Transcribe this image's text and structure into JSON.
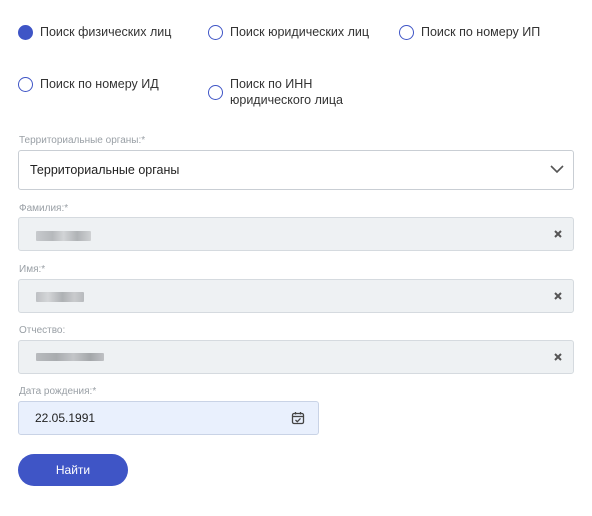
{
  "search_types": [
    {
      "label": "Поиск физических лиц",
      "checked": true
    },
    {
      "label": "Поиск юридических лиц",
      "checked": false
    },
    {
      "label": "Поиск по номеру ИП",
      "checked": false
    },
    {
      "label": "Поиск по номеру ИД",
      "checked": false
    },
    {
      "label": "Поиск по ИНН юридического лица",
      "checked": false
    }
  ],
  "form": {
    "territorial": {
      "label": "Территориальные органы:*",
      "value": "Территориальные органы"
    },
    "lastname": {
      "label": "Фамилия:*"
    },
    "firstname": {
      "label": "Имя:*"
    },
    "patronymic": {
      "label": "Отчество:"
    },
    "birthdate": {
      "label": "Дата рождения:*",
      "value": "22.05.1991"
    },
    "submit_label": "Найти"
  },
  "colors": {
    "accent": "#3f55c6",
    "input_bg": "#eef1f3",
    "date_bg": "#e9f0fd"
  },
  "icons": {
    "select": "chevron-down-icon",
    "clear": "clear-x-icon",
    "date": "calendar-icon"
  }
}
